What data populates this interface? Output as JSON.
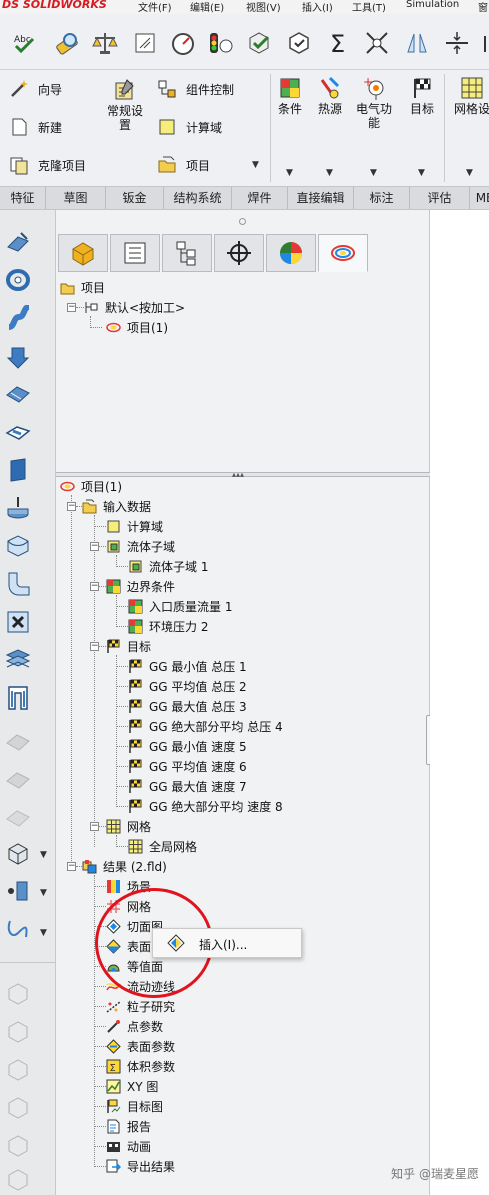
{
  "menubar": {
    "logo": "DS SOLIDWORKS",
    "items": [
      "文件(F)",
      "编辑(E)",
      "视图(V)",
      "插入(I)",
      "工具(T)",
      "Simulation",
      "窗"
    ]
  },
  "command_manager": {
    "col1": [
      "向导",
      "新建",
      "克隆项目"
    ],
    "col2_top": "常规设置",
    "col3": [
      "组件控制",
      "计算域",
      "项目"
    ],
    "big_buttons": [
      "条件",
      "热源",
      "电气功能",
      "目标",
      "网格设"
    ]
  },
  "tabs": [
    "特征",
    "草图",
    "钣金",
    "结构系统",
    "焊件",
    "直接编辑",
    "标注",
    "评估",
    "MB"
  ],
  "tree_top": {
    "root": "项目",
    "config": "默认<按加工>",
    "project": "项目(1)"
  },
  "tree": {
    "root": "项目(1)",
    "input_data": "输入数据",
    "comp_domain": "计算域",
    "fluid_subdomains": "流体子域",
    "fluid_subdomain_1": "流体子域 1",
    "boundary_conditions": "边界条件",
    "inlet_mass_flow": "入口质量流量 1",
    "env_pressure": "环境压力 2",
    "goals": "目标",
    "goal_items": [
      "GG 最小值 总压 1",
      "GG 平均值 总压 2",
      "GG 最大值 总压 3",
      "GG 绝大部分平均 总压 4",
      "GG 最小值 速度 5",
      "GG 平均值 速度 6",
      "GG 最大值 速度 7",
      "GG 绝大部分平均 速度 8"
    ],
    "mesh": "网格",
    "global_mesh": "全局网格",
    "results": "结果 (2.fld)",
    "result_items": [
      "场景",
      "网格",
      "切面图",
      "表面图",
      "等值面",
      "流动迹线",
      "粒子研究",
      "点参数",
      "表面参数",
      "体积参数",
      "XY 图",
      "目标图",
      "报告",
      "动画",
      "导出结果"
    ]
  },
  "context_menu": {
    "insert": "插入(I)..."
  },
  "watermark": "知乎 @瑞麦星愿"
}
